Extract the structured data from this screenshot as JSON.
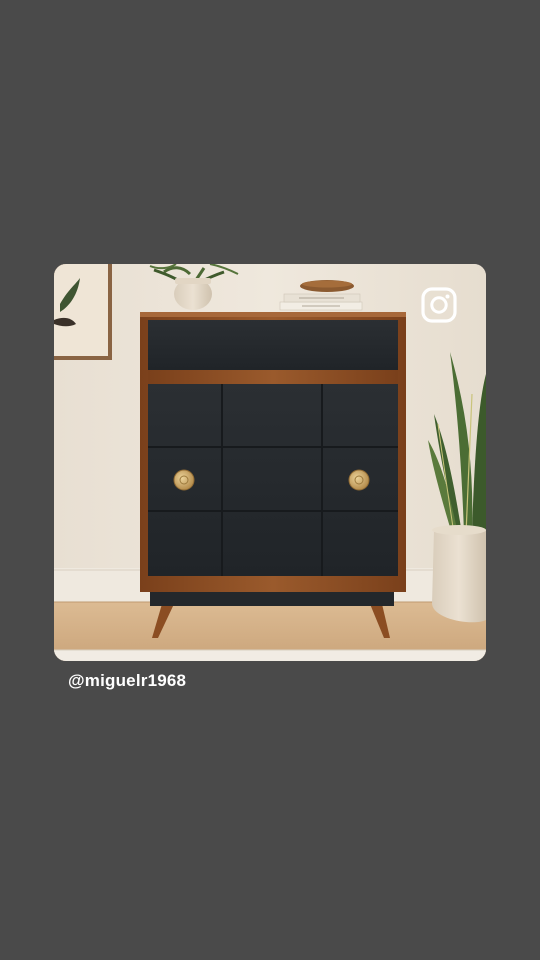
{
  "post": {
    "username": "@miguelr1968",
    "badge_icon": "instagram-icon",
    "photo_subject": "wood-and-black-dresser-icon"
  },
  "colors": {
    "background": "#4a4a4a",
    "wall": "#ece4d8",
    "floor": "#d6b48c",
    "wood": "#8b4d22",
    "drawer_front": "#25292d",
    "brass_knob": "#caa463",
    "username_text": "#ffffff"
  }
}
